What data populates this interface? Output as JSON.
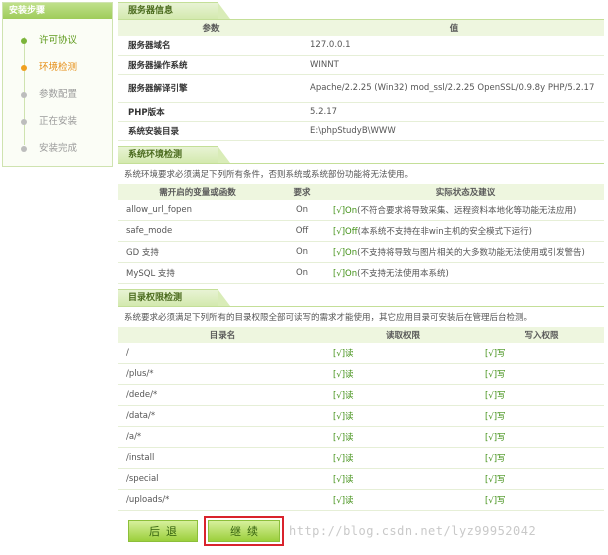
{
  "sidebar": {
    "title": "安装步骤",
    "steps": [
      {
        "label": "许可协议",
        "state": "done"
      },
      {
        "label": "环境检测",
        "state": "active"
      },
      {
        "label": "参数配置",
        "state": "pending"
      },
      {
        "label": "正在安装",
        "state": "pending"
      },
      {
        "label": "安装完成",
        "state": "pending"
      }
    ]
  },
  "server": {
    "title": "服务器信息",
    "col_param": "参数",
    "col_value": "值",
    "rows": [
      {
        "k": "服务器域名",
        "v": "127.0.0.1"
      },
      {
        "k": "服务器操作系统",
        "v": "WINNT"
      },
      {
        "k": "服务器解译引擎",
        "v": "Apache/2.2.25 (Win32) mod_ssl/2.2.25 OpenSSL/0.9.8y PHP/5.2.17"
      },
      {
        "k": "PHP版本",
        "v": "5.2.17"
      },
      {
        "k": "系统安装目录",
        "v": "E:\\phpStudyB\\WWW"
      }
    ]
  },
  "env": {
    "title": "系统环境检测",
    "note": "系统环境要求必须满足下列所有条件，否则系统或系统部份功能将无法使用。",
    "col_item": "需开启的变量或函数",
    "col_req": "要求",
    "col_status": "实际状态及建议",
    "rows": [
      {
        "n": "allow_url_fopen",
        "r": "On",
        "mark": "[√]On",
        "s": "(不符合要求将导致采集、远程资料本地化等功能无法应用)"
      },
      {
        "n": "safe_mode",
        "r": "Off",
        "mark": "[√]Off",
        "s": "(本系统不支持在非win主机的安全模式下运行)"
      },
      {
        "n": "GD 支持",
        "r": "On",
        "mark": "[√]On",
        "s": "(不支持将导致与图片相关的大多数功能无法使用或引发警告)"
      },
      {
        "n": "MySQL 支持",
        "r": "On",
        "mark": "[√]On",
        "s": "(不支持无法使用本系统)"
      }
    ]
  },
  "dirs": {
    "title": "目录权限检测",
    "note": "系统要求必须满足下列所有的目录权限全部可读写的需求才能使用，其它应用目录可安装后在管理后台检测。",
    "col_dir": "目录名",
    "col_read": "读取权限",
    "col_write": "写入权限",
    "rows": [
      {
        "p": "/",
        "rd": "[√]读",
        "wr": "[√]写"
      },
      {
        "p": "/plus/*",
        "rd": "[√]读",
        "wr": "[√]写"
      },
      {
        "p": "/dede/*",
        "rd": "[√]读",
        "wr": "[√]写"
      },
      {
        "p": "/data/*",
        "rd": "[√]读",
        "wr": "[√]写"
      },
      {
        "p": "/a/*",
        "rd": "[√]读",
        "wr": "[√]写"
      },
      {
        "p": "/install",
        "rd": "[√]读",
        "wr": "[√]写"
      },
      {
        "p": "/special",
        "rd": "[√]读",
        "wr": "[√]写"
      },
      {
        "p": "/uploads/*",
        "rd": "[√]读",
        "wr": "[√]写"
      }
    ]
  },
  "buttons": {
    "prev": "后退",
    "next": "继续"
  },
  "watermark": "http://blog.csdn.net/lyz99952042"
}
